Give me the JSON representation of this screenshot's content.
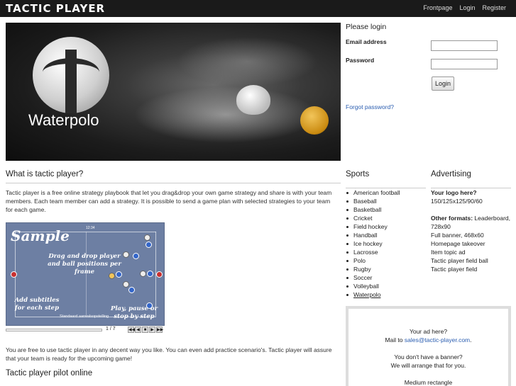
{
  "header": {
    "logo": "TACTIC PLAYER",
    "nav": [
      "Frontpage",
      "Login",
      "Register"
    ]
  },
  "hero": {
    "title": "Waterpolo"
  },
  "login": {
    "heading": "Please login",
    "email_label": "Email address",
    "email_value": "",
    "password_label": "Password",
    "password_value": "",
    "button": "Login",
    "forgot": "Forgot password?"
  },
  "about": {
    "title": "What is tactic player?",
    "intro": "Tactic player is a free online strategy playbook that let you drag&drop your own game strategy and share is with your team members. Each team member can add a strategy. It is possible to send a game plan with selected strategies to your team for each game.",
    "usage": "You are free to use tactic player in any decent way you like. You can even add practice scenario's. Tactic player will assure that your team is ready for the upcoming game!",
    "pilot_title": "Tactic player pilot online"
  },
  "sample": {
    "title": "Sample",
    "drag_text": "Drag and drop player and ball positions per frame",
    "subtitles_text": "Add subtitles for each step",
    "play_text": "Play, pause or stop by step",
    "caption": "Standaard aanvalsopstelling",
    "counter": "1 / 7",
    "score": "12:34"
  },
  "sports": {
    "title": "Sports",
    "items": [
      "American football",
      "Baseball",
      "Basketball",
      "Cricket",
      "Field hockey",
      "Handball",
      "Ice hockey",
      "Lacrosse",
      "Polo",
      "Rugby",
      "Soccer",
      "Volleyball",
      "Waterpolo"
    ]
  },
  "advertising": {
    "title": "Advertising",
    "logo_heading": "Your logo here?",
    "logo_sizes": "150/125x125/90/60",
    "other_heading": "Other formats:",
    "other_first": "Leaderboard, 728x90",
    "formats": [
      "Full banner, 468x60",
      "Homepage takeover",
      "Item topic ad",
      "Tactic player field ball",
      "Tactic player field"
    ],
    "box": {
      "line1": "Your ad here?",
      "mail_prefix": "Mail to",
      "mail": "sales@tactic-player.com",
      "mail_suffix": ".",
      "line3": "You don't have a banner?",
      "line4": "We will arrange that for you.",
      "line5": "Medium rectangle"
    }
  }
}
